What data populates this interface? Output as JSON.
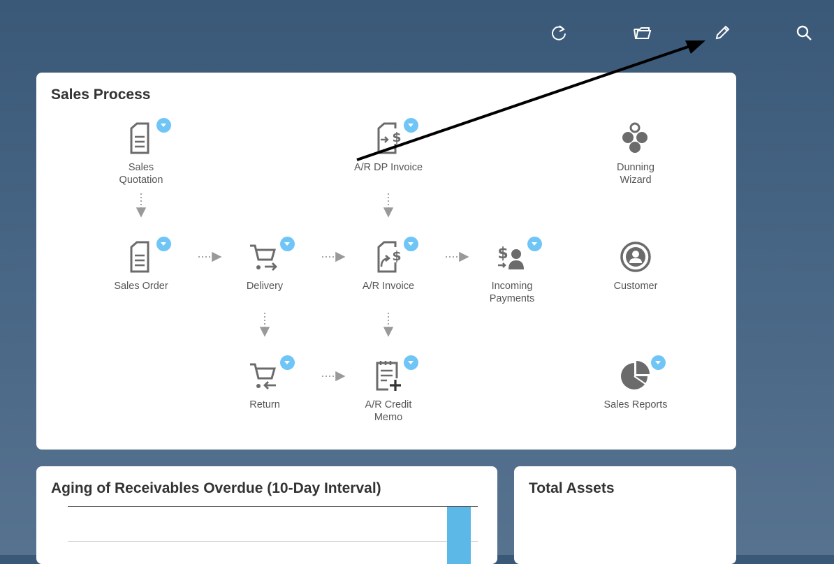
{
  "toolbar": {
    "buttons": [
      {
        "name": "refresh-icon"
      },
      {
        "name": "folder-icon"
      },
      {
        "name": "edit-icon"
      },
      {
        "name": "search-icon"
      }
    ]
  },
  "sales_process": {
    "title": "Sales Process",
    "nodes": {
      "sales_quotation": "Sales\nQuotation",
      "ar_dp_invoice": "A/R DP Invoice",
      "dunning_wizard": "Dunning\nWizard",
      "sales_order": "Sales Order",
      "delivery": "Delivery",
      "ar_invoice": "A/R Invoice",
      "incoming_payments": "Incoming\nPayments",
      "customer": "Customer",
      "return": "Return",
      "ar_credit_memo": "A/R Credit\nMemo",
      "sales_reports": "Sales Reports"
    }
  },
  "aging": {
    "title": "Aging of Receivables Overdue (10-Day Interval)"
  },
  "total_assets": {
    "title": "Total Assets"
  },
  "colors": {
    "accent": "#70c5f7",
    "bar": "#5cb8e6",
    "icon": "#6b6b6b",
    "annotation": "#000000"
  }
}
